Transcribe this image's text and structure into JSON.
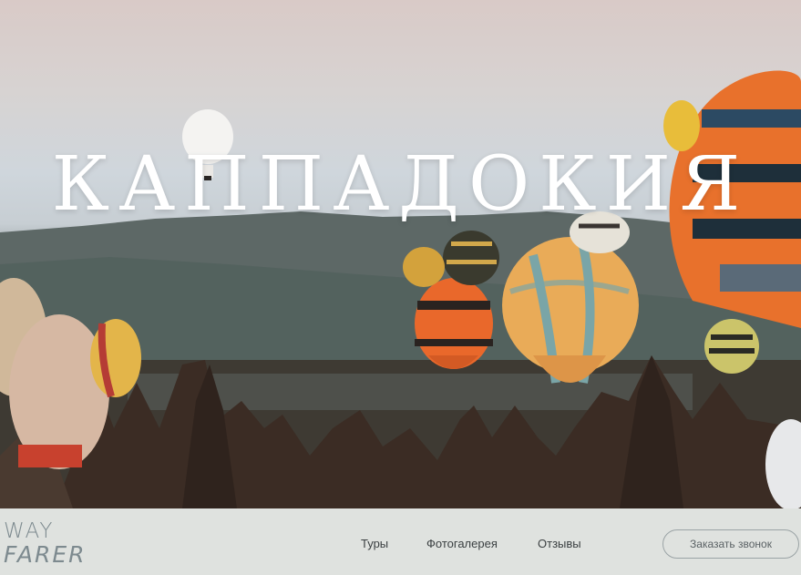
{
  "hero": {
    "title": "КАППАДОКИЯ"
  },
  "logo": {
    "line1": "WAY",
    "line2": "FARER"
  },
  "nav": {
    "items": [
      {
        "label": "Туры"
      },
      {
        "label": "Фотогалерея"
      },
      {
        "label": "Отзывы"
      }
    ]
  },
  "cta": {
    "label": "Заказать звонок"
  },
  "colors": {
    "footer_bg": "#dfe2df",
    "logo": "#7d8a8f",
    "nav_text": "#3a3f41",
    "button_border": "#9aa3a5"
  }
}
